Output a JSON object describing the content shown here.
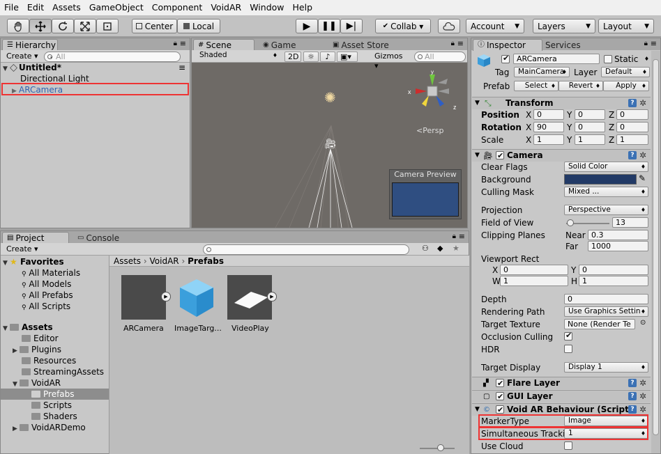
{
  "menu": [
    "File",
    "Edit",
    "Assets",
    "GameObject",
    "Component",
    "VoidAR",
    "Window",
    "Help"
  ],
  "toolbar": {
    "center": "Center",
    "local": "Local",
    "collab": "Collab ▾",
    "account": "Account",
    "layers": "Layers",
    "layout": "Layout"
  },
  "hierarchy": {
    "tab": "Hierarchy",
    "create": "Create",
    "search": "All",
    "scene": "Untitled*",
    "items": [
      "Directional Light",
      "ARCamera"
    ]
  },
  "scene_view": {
    "tabs": [
      "Scene",
      "Game",
      "Asset Store"
    ],
    "shading": "Shaded",
    "mode2d": "2D",
    "gizmos": "Gizmos",
    "search": "All",
    "persp": "Persp",
    "preview_title": "Camera Preview"
  },
  "project": {
    "tabs": [
      "Project",
      "Console"
    ],
    "create": "Create",
    "favorites_title": "Favorites",
    "favorites": [
      "All Materials",
      "All Models",
      "All Prefabs",
      "All Scripts"
    ],
    "assets_title": "Assets",
    "folders": [
      "Editor",
      "Plugins",
      "Resources",
      "StreamingAssets",
      "VoidAR",
      "Prefabs",
      "Scripts",
      "Shaders",
      "VoidARDemo"
    ],
    "breadcrumb": [
      "Assets",
      "VoidAR",
      "Prefabs"
    ],
    "assets": [
      "ARCamera",
      "ImageTarg...",
      "VideoPlay"
    ]
  },
  "inspector": {
    "tabs": [
      "Inspector",
      "Services"
    ],
    "object_name": "ARCamera",
    "static": "Static",
    "tag_label": "Tag",
    "tag": "MainCamera",
    "layer_label": "Layer",
    "layer": "Default",
    "prefab_label": "Prefab",
    "select": "Select",
    "revert": "Revert",
    "apply": "Apply",
    "transform": {
      "title": "Transform",
      "position": {
        "label": "Position",
        "x": "0",
        "y": "0",
        "z": "0"
      },
      "rotation": {
        "label": "Rotation",
        "x": "90",
        "y": "0",
        "z": "0"
      },
      "scale": {
        "label": "Scale",
        "x": "1",
        "y": "1",
        "z": "1"
      }
    },
    "camera": {
      "title": "Camera",
      "clear_flags_label": "Clear Flags",
      "clear_flags": "Solid Color",
      "background_label": "Background",
      "background_color": "#223a66",
      "culling_label": "Culling Mask",
      "culling": "Mixed ...",
      "projection_label": "Projection",
      "projection": "Perspective",
      "fov_label": "Field of View",
      "fov": "13",
      "clipping_label": "Clipping Planes",
      "near_label": "Near",
      "near": "0.3",
      "far_label": "Far",
      "far": "1000",
      "viewport_label": "Viewport Rect",
      "vx": "0",
      "vy": "0",
      "vw": "1",
      "vh": "1",
      "depth_label": "Depth",
      "depth": "0",
      "render_path_label": "Rendering Path",
      "render_path": "Use Graphics Settin",
      "target_tex_label": "Target Texture",
      "target_tex": "None (Render Te",
      "occlusion_label": "Occlusion Culling",
      "hdr_label": "HDR",
      "target_display_label": "Target Display",
      "target_display": "Display 1"
    },
    "flare": "Flare Layer",
    "gui": "GUI Layer",
    "void_ar": {
      "title": "Void AR Behaviour (Script)",
      "marker_label": "MarkerType",
      "marker": "Image",
      "simul_label": "Simultaneous Tracki",
      "simul": "1",
      "cloud_label": "Use Cloud"
    }
  },
  "colors": {
    "accent": "#3b71b4",
    "highlight": "#e33333",
    "scene_bg": "#6e6a66"
  }
}
